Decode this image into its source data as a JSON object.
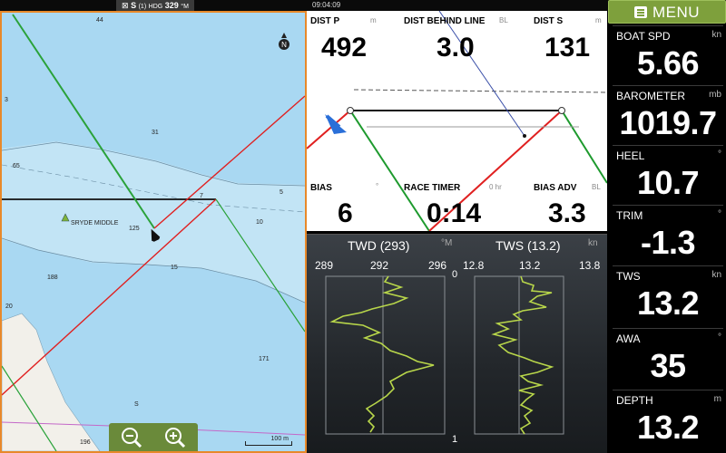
{
  "status_bar": {
    "satellite": "S",
    "satellite_count": "(1)",
    "heading_label": "HDG",
    "heading_value": "329",
    "heading_unit": "°M",
    "time": "09:04:09"
  },
  "chart": {
    "place_label": "SRYDE MIDDLE",
    "north_label": "N",
    "scale_label": "100 m",
    "depth_soundings": [
      "44",
      "3",
      "65",
      "31",
      "7",
      "5",
      "10",
      "125",
      "15",
      "188",
      "20",
      "171",
      "S",
      "196"
    ],
    "zoom_out_label": "zoom out",
    "zoom_in_label": "zoom in"
  },
  "startline": {
    "dist_p": {
      "label": "DIST P",
      "unit": "m",
      "value": "492"
    },
    "dist_behind": {
      "label": "DIST BEHIND LINE",
      "unit": "BL",
      "value": "3.0"
    },
    "dist_s": {
      "label": "DIST S",
      "unit": "m",
      "value": "131"
    },
    "bias": {
      "label": "BIAS",
      "unit": "°",
      "value": "6"
    },
    "race_timer": {
      "label": "RACE TIMER",
      "unit": "0 hr",
      "value": "0:14"
    },
    "bias_adv": {
      "label": "BIAS ADV",
      "unit": "BL",
      "value": "3.3"
    }
  },
  "trend": {
    "twd_title": "TWD (293)",
    "twd_unit": "°M",
    "tws_title": "TWS (13.2)",
    "tws_unit": "kn",
    "twd_ticks": [
      "289",
      "292",
      "296"
    ],
    "tws_ticks": [
      "12.8",
      "13.2",
      "13.8"
    ],
    "time_top": "0",
    "time_bottom": "1",
    "colors": {
      "trace": "#b8d64a",
      "grid": "#8a8f94"
    }
  },
  "sidebar": {
    "menu_label": "MENU",
    "items": [
      {
        "label": "BOAT SPD",
        "unit": "kn",
        "value": "5.66"
      },
      {
        "label": "BAROMETER",
        "unit": "mb",
        "value": "1019.7"
      },
      {
        "label": "HEEL",
        "unit": "°",
        "value": "10.7"
      },
      {
        "label": "TRIM",
        "unit": "°",
        "value": "-1.3"
      },
      {
        "label": "TWS",
        "unit": "kn",
        "value": "13.2"
      },
      {
        "label": "AWA",
        "unit": "°",
        "value": "35"
      },
      {
        "label": "DEPTH",
        "unit": "m",
        "value": "13.2"
      }
    ]
  },
  "colors": {
    "accent_orange": "#e8892a",
    "menu_green": "#7ea03c",
    "port_red": "#e02020",
    "stbd_green": "#1e9a2e",
    "water_light": "#a9d8f2",
    "water_deep": "#c2e4f5"
  }
}
